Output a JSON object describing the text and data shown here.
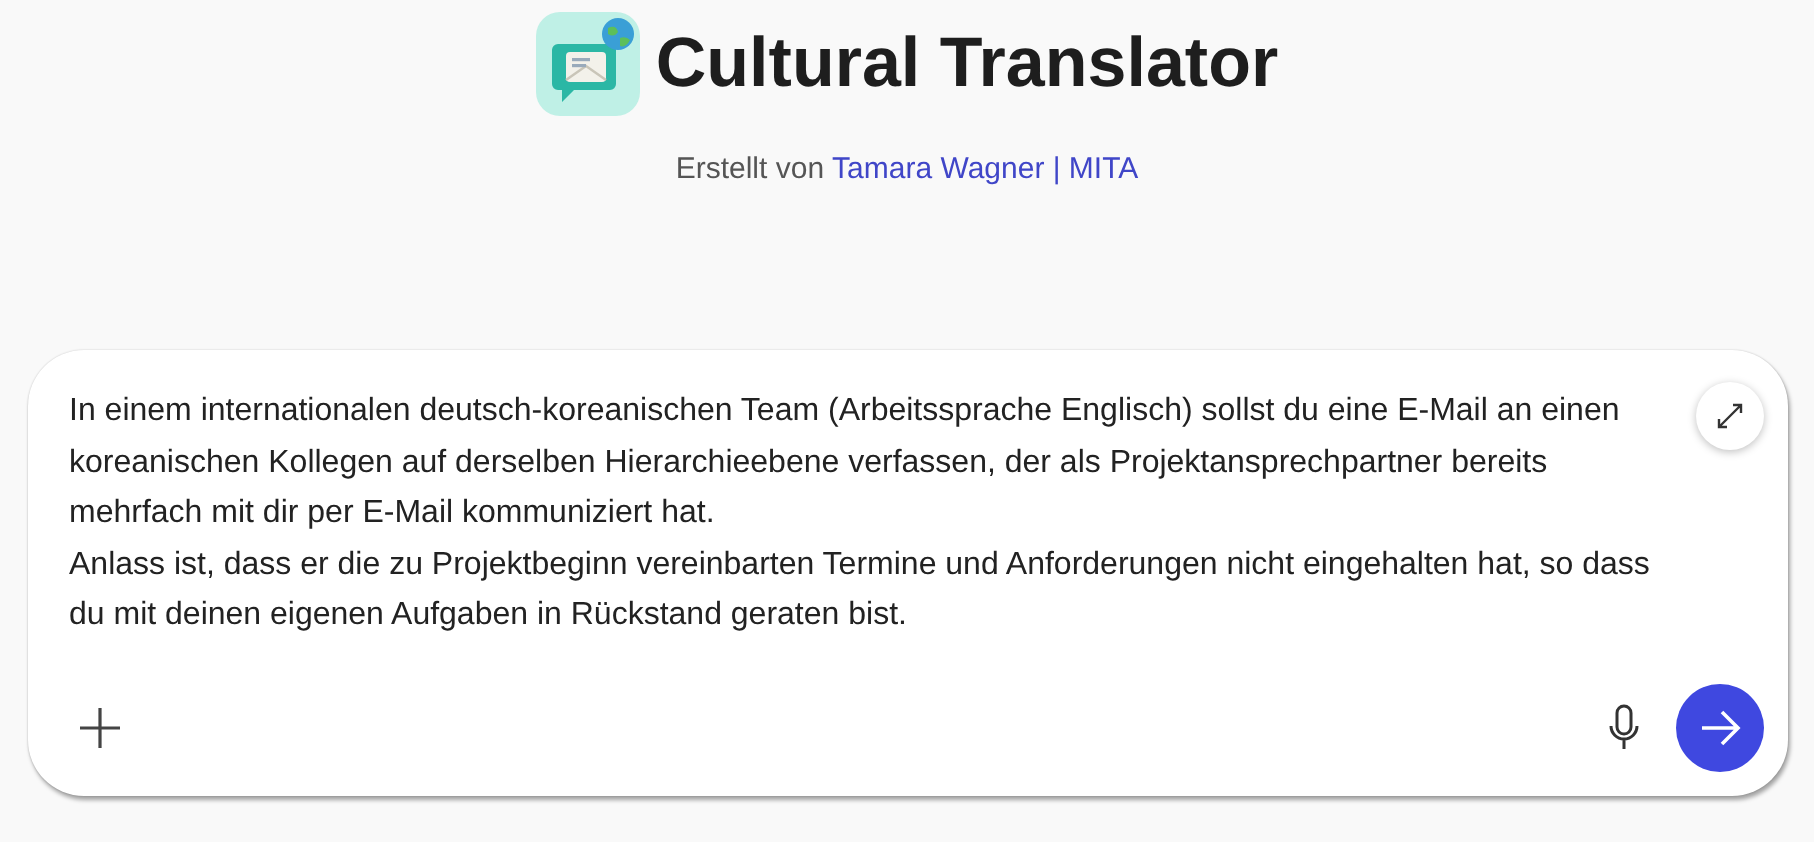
{
  "header": {
    "title": "Cultural Translator",
    "byline": {
      "prefix": "Erstellt von",
      "author": "Tamara Wagner | MITA"
    }
  },
  "composer": {
    "value": "In einem internationalen deutsch-koreanischen Team (Arbeitssprache Englisch) sollst du eine E-Mail an einen koreanischen Kollegen auf derselben Hierarchieebene verfassen, der als Projektansprechpartner bereits mehrfach mit dir per E-Mail kommuniziert hat.\nAnlass ist, dass er die zu Projektbeginn vereinbarten Termine und Anforderungen nicht eingehalten hat, so dass du mit deinen eigenen Aufgaben in Rückstand geraten bist."
  }
}
